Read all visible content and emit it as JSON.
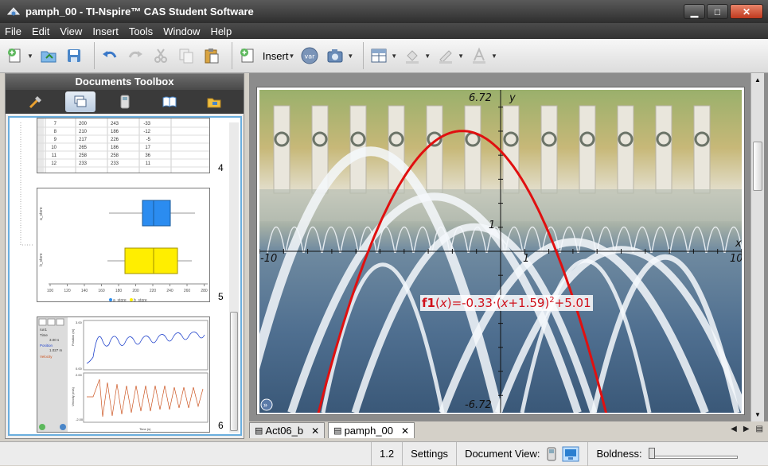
{
  "window": {
    "title": "pamph_00 - TI-Nspire™ CAS Student Software",
    "controls": {
      "minimize": "▁",
      "maximize": "□",
      "close": "✕"
    }
  },
  "menu": [
    "File",
    "Edit",
    "View",
    "Insert",
    "Tools",
    "Window",
    "Help"
  ],
  "toolbar": {
    "insert_label": "Insert",
    "var_label": "var"
  },
  "toolbox": {
    "title": "Documents Toolbox",
    "tabs": [
      "tools-icon",
      "page-sorter-icon",
      "calculator-icon",
      "content-explorer-icon",
      "utilities-icon"
    ]
  },
  "page_sorter": {
    "pages": [
      {
        "number": "4",
        "table_rows": [
          [
            "7",
            "200",
            "243",
            "-33"
          ],
          [
            "8",
            "210",
            "186",
            "-12"
          ],
          [
            "9",
            "217",
            "226",
            "-5"
          ],
          [
            "10",
            "265",
            "186",
            "17"
          ],
          [
            "11",
            "258",
            "258",
            "36"
          ],
          [
            "12",
            "233",
            "233",
            "11"
          ]
        ]
      },
      {
        "number": "5",
        "x_ticks": [
          "100",
          "120",
          "140",
          "160",
          "180",
          "200",
          "220",
          "240",
          "260",
          "280"
        ],
        "y_labels": [
          "a_store",
          "b_store"
        ],
        "legend": [
          "a_store",
          "b_store"
        ]
      },
      {
        "number": "6",
        "side_text": [
          "run1",
          "Time",
          "3.00 s",
          "Position",
          "1.027 m",
          "Velocity"
        ],
        "top_ylabel": "Position (m)",
        "bottom_ylabel": "Velocity (m/s)",
        "xlabel": "Time (s)",
        "top_ticks": [
          "3.00",
          "0.00"
        ],
        "bottom_ticks": [
          "2.00",
          "-2.00"
        ]
      }
    ]
  },
  "graph": {
    "ymax_label": "6.72",
    "ymin_label": "-6.72",
    "xmin_label": "-10",
    "xmax_label": "10",
    "x_unit_label": "1",
    "y_unit_label": "1",
    "x_axis_name": "x",
    "y_axis_name": "y",
    "function": {
      "name": "f1",
      "var": "x",
      "expr_before": "=-0.33·(",
      "expr_var": "x",
      "expr_after": "+1.59)",
      "exponent": "2",
      "constant": "+5.01",
      "color": "#e01010",
      "a": -0.33,
      "h": -1.59,
      "k": 5.01
    },
    "window": {
      "xmin": -10,
      "xmax": 10,
      "ymin": -6.72,
      "ymax": 6.72
    }
  },
  "tabs": [
    {
      "label": "Act06_b",
      "close": "✕"
    },
    {
      "label": "pamph_00",
      "close": "✕"
    }
  ],
  "statusbar": {
    "page": "1.2",
    "settings": "Settings",
    "document_view": "Document View:",
    "boldness": "Boldness:"
  }
}
